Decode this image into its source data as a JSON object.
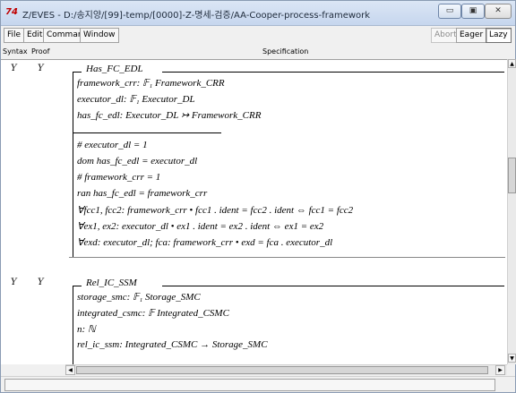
{
  "titlebar": {
    "app_icon": "74",
    "title": "Z/EVES - D:/송지양/[99]-temp/[0000]-Z-명세-검증/AA-Cooper-process-framework"
  },
  "window_buttons": {
    "minimize": "▭",
    "maximize": "▣",
    "close": "✕"
  },
  "toolbar": {
    "menus": [
      "File",
      "Edit",
      "Command",
      "Window"
    ],
    "abort": "Abort",
    "eager": "Eager",
    "lazy": "Lazy"
  },
  "columns": {
    "syntax": "Syntax",
    "proof": "Proof",
    "spec": "Specification"
  },
  "schema1": {
    "syntax_flag": "Y",
    "proof_flag": "Y",
    "name": "Has_FC_EDL",
    "decls": [
      "framework_crr: 𝔽₁ Framework_CRR",
      "executor_dl: 𝔽₁ Executor_DL",
      "has_fc_edl: Executor_DL ↣ Framework_CRR"
    ],
    "preds": [
      "# executor_dl = 1",
      "dom has_fc_edl = executor_dl",
      "# framework_crr = 1",
      "ran has_fc_edl = framework_crr",
      "∀fcc1, fcc2: framework_crr •  fcc1 . ident = fcc2 . ident ⇔ fcc1 = fcc2",
      "∀ex1, ex2: executor_dl •  ex1 . ident = ex2 . ident ⇔ ex1 = ex2",
      "∀exd: executor_dl; fca: framework_crr •  exd = fca . executor_dl"
    ]
  },
  "schema2": {
    "syntax_flag": "Y",
    "proof_flag": "Y",
    "name": "Rel_IC_SSM",
    "decls": [
      "storage_smc: 𝔽₁ Storage_SMC",
      "integrated_csmc: 𝔽 Integrated_CSMC",
      "n: ℕ",
      "rel_ic_ssm: Integrated_CSMC → Storage_SMC"
    ]
  },
  "scroll": {
    "up": "▲",
    "down": "▼",
    "left": "◀",
    "right": "▶"
  }
}
